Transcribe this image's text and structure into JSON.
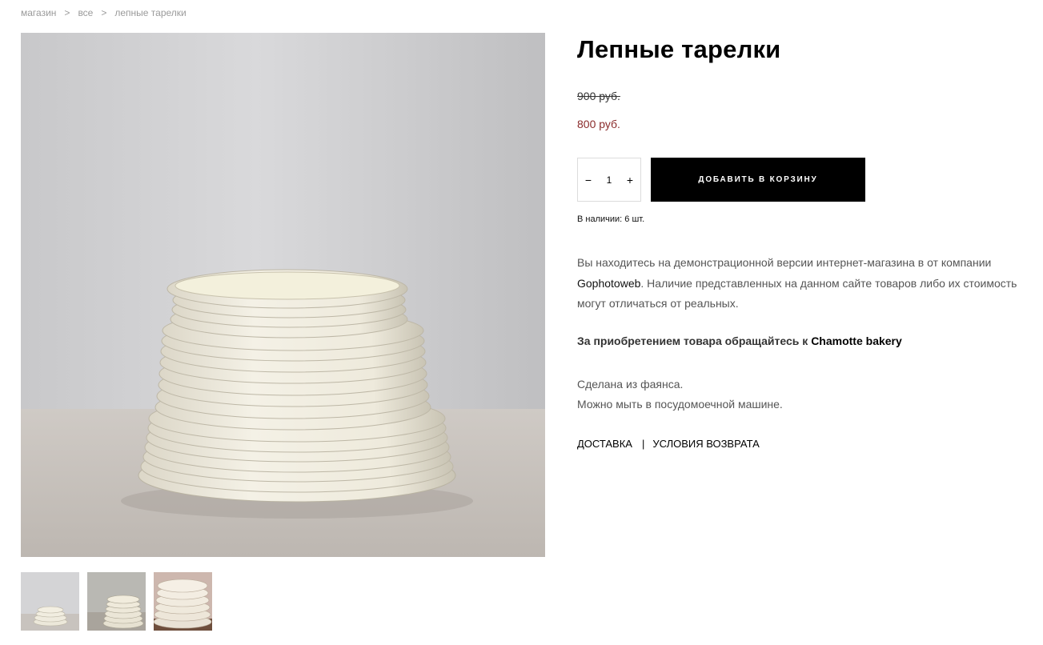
{
  "breadcrumb": {
    "items": [
      "магазин",
      "все",
      "лепные тарелки"
    ],
    "separator": ">"
  },
  "product": {
    "title": "Лепные тарелки",
    "old_price": "900 руб.",
    "new_price": "800 руб.",
    "quantity": "1",
    "minus_label": "−",
    "plus_label": "+",
    "add_to_cart_label": "ДОБАВИТЬ В КОРЗИНУ",
    "stock_label": "В наличии:",
    "stock_value": "6 шт."
  },
  "description": {
    "part1": "Вы находитесь на демонстрационной версии интернет-магазина в от компании ",
    "company": "Gophotoweb",
    "part2": ". Наличие представленных на данном сайте товаров либо их стоимость могут отличаться от реальных."
  },
  "contact": {
    "prefix": "За приобретением товара обращайтесь к ",
    "name": "Chamotte bakery"
  },
  "material": {
    "line1": "Сделана из фаянса.",
    "line2": "Можно мыть в посудомоечной машине."
  },
  "links": {
    "delivery": "ДОСТАВКА",
    "separator": "|",
    "returns": "УСЛОВИЯ ВОЗВРАТА"
  },
  "thumbnails": [
    "plates-stack-front",
    "plates-stack-side",
    "plates-stack-closeup"
  ],
  "colors": {
    "price_accent": "#8a2b2b",
    "button_bg": "#000000",
    "breadcrumb": "#9a9a9a"
  }
}
